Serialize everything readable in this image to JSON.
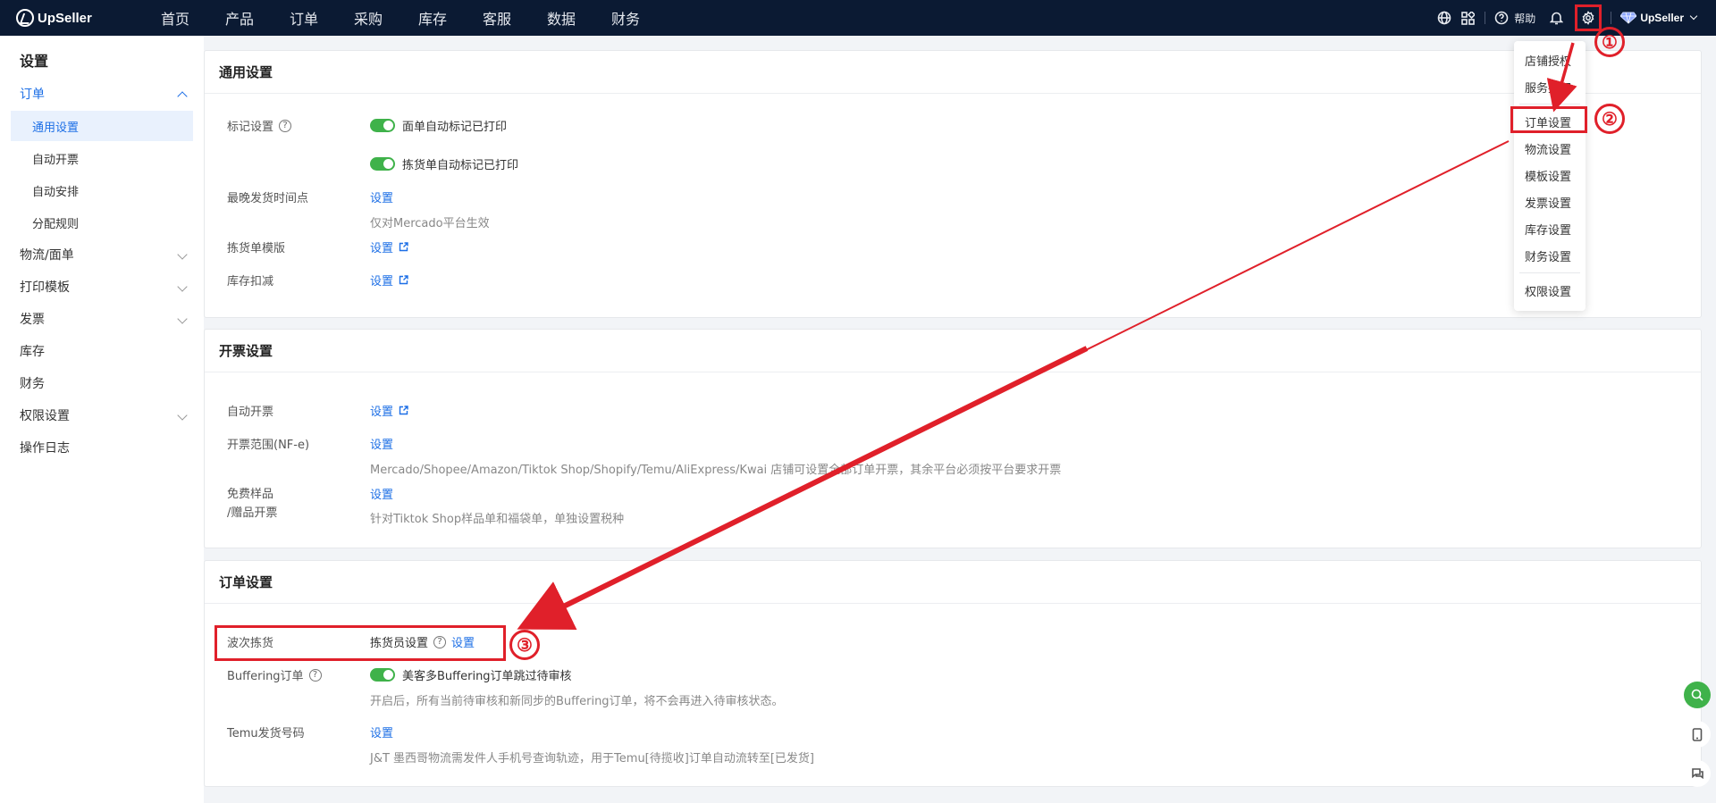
{
  "brand": {
    "name": "UpSeller"
  },
  "topnav": {
    "items": [
      "首页",
      "产品",
      "订单",
      "采购",
      "库存",
      "客服",
      "数据",
      "财务"
    ],
    "help_label": "帮助",
    "user_name": "UpSeller"
  },
  "sidebar": {
    "title": "设置",
    "items": [
      {
        "label": "订单"
      },
      {
        "label": "通用设置"
      },
      {
        "label": "自动开票"
      },
      {
        "label": "自动安排"
      },
      {
        "label": "分配规则"
      },
      {
        "label": "物流/面单"
      },
      {
        "label": "打印模板"
      },
      {
        "label": "发票"
      },
      {
        "label": "库存"
      },
      {
        "label": "财务"
      },
      {
        "label": "权限设置"
      },
      {
        "label": "操作日志"
      }
    ]
  },
  "general": {
    "title": "通用设置",
    "mark_label": "标记设置",
    "toggle1_label": "面单自动标记已打印",
    "toggle2_label": "拣货单自动标记已打印",
    "latest_ship_label": "最晚发货时间点",
    "latest_ship_link": "设置",
    "latest_ship_hint": "仅对Mercado平台生效",
    "picklist_label": "拣货单模版",
    "picklist_link": "设置",
    "stock_label": "库存扣减",
    "stock_link": "设置"
  },
  "invoice": {
    "title": "开票设置",
    "auto_label": "自动开票",
    "auto_link": "设置",
    "range_label": "开票范围(NF-e)",
    "range_link": "设置",
    "range_hint": "Mercado/Shopee/Amazon/Tiktok Shop/Shopify/Temu/AliExpress/Kwai 店铺可设置全部订单开票，其余平台必须按平台要求开票",
    "free_label_1": "免费样品",
    "free_label_2": "/赠品开票",
    "free_link": "设置",
    "free_hint": "针对Tiktok Shop样品单和福袋单，单独设置税种"
  },
  "order": {
    "title": "订单设置",
    "wave_label": "波次拣货",
    "wave_picker_label": "拣货员设置",
    "wave_link": "设置",
    "buffering_label": "Buffering订单",
    "buffering_toggle_label": "美客多Buffering订单跳过待审核",
    "buffering_hint": "开启后，所有当前待审核和新同步的Buffering订单，将不会再进入待审核状态。",
    "temu_label": "Temu发货号码",
    "temu_link": "设置",
    "temu_hint": "J&T 墨西哥物流需发件人手机号查询轨迹，用于Temu[待揽收]订单自动流转至[已发货]"
  },
  "dropdown": {
    "items": [
      "店铺授权",
      "服务授权",
      "订单设置",
      "物流设置",
      "模板设置",
      "发票设置",
      "库存设置",
      "财务设置",
      "权限设置"
    ]
  },
  "annotations": {
    "n1": "①",
    "n2": "②",
    "n3": "③"
  },
  "colors": {
    "accent": "#1d6fe6",
    "nav_bg": "#0b1a33",
    "annotation": "#e0202a",
    "toggle_on": "#3fb24a"
  }
}
